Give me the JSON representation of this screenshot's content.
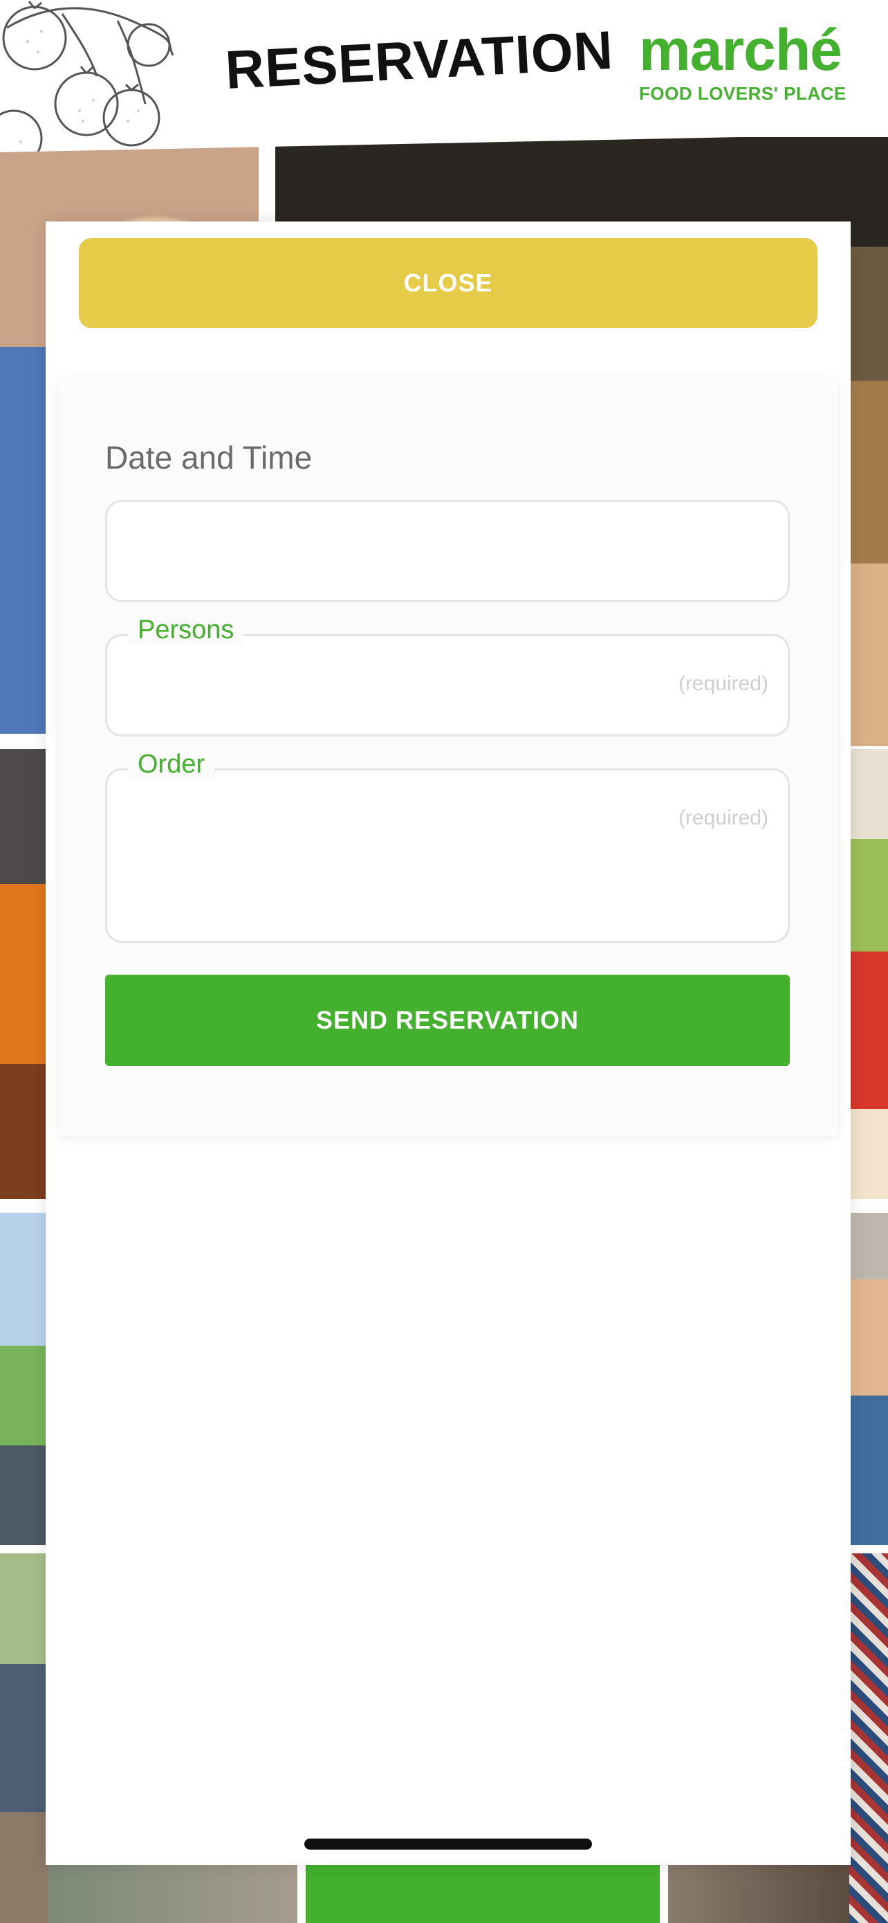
{
  "header": {
    "title": "RESERVATION",
    "brand_name": "marché",
    "brand_tagline": "FOOD LOVERS' PLACE"
  },
  "modal": {
    "close_label": "CLOSE",
    "form": {
      "datetime_heading": "Date and Time",
      "datetime_value": "",
      "persons_label": "Persons",
      "persons_hint": "(required)",
      "persons_value": "",
      "order_label": "Order",
      "order_hint": "(required)",
      "order_value": "",
      "send_label": "SEND RESERVATION"
    }
  },
  "colors": {
    "brand_green": "#43b02e",
    "close_yellow": "#e5cb47",
    "heading_gray": "#6a6a6a",
    "hint_gray": "#cfcfcf"
  },
  "icons": {
    "header_art": "tomato-vine-illustration"
  }
}
